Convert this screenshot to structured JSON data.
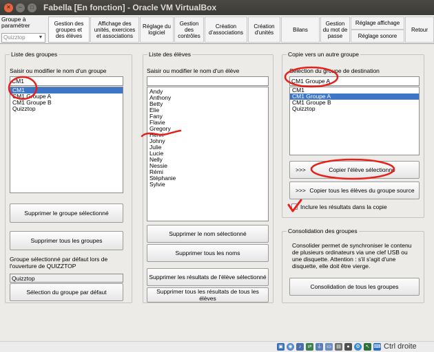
{
  "window": {
    "title": "Fabella [En fonction] - Oracle VM VirtualBox"
  },
  "toolbar": {
    "combo_label": "Groupe à\nparamétrer",
    "combo_value": "Quizztop",
    "tabs": [
      "Gestion des\ngroupes et\ndes élèves",
      "Affichage des\nunités, exercices\net associations",
      "Réglage du\nlogiciel",
      "Gestion\ndes\ncontrôles",
      "Création\nd'associations",
      "Création\nd'unités",
      "Bilans",
      "Gestion\ndu mot de\npasse",
      "Réglage affichage",
      "Réglage sonore",
      "Retour"
    ]
  },
  "groups_panel": {
    "legend": "Liste des groupes",
    "input_label": "Saisir ou modifier le nom d'un groupe",
    "input_value": "CM1",
    "items": [
      "CM1",
      "CM1 Groupe A",
      "CM1 Groupe B",
      "Quizztop"
    ],
    "selected_index": 0,
    "delete_selected": "Supprimer le groupe sélectionné",
    "delete_all": "Supprimer tous les groupes",
    "default_label": "Groupe sélectionné par défaut lors de\nl'ouverture de QUIZZTOP",
    "default_value": "Quizztop",
    "set_default": "Sélection du groupe par défaut"
  },
  "students_panel": {
    "legend": "Liste des élèves",
    "input_label": "Saisir ou modifier le nom d'un élève",
    "input_value": "",
    "items": [
      "Andy",
      "Anthony",
      "Betty",
      "Elie",
      "Fany",
      "Flavie",
      "Gregory",
      "Henri",
      "Johny",
      "Julie",
      "Lucie",
      "Nelly",
      "Nessie",
      "Rémi",
      "Stéphanie",
      "Sylvie"
    ],
    "delete_name": "Supprimer le nom sélectionné",
    "delete_all_names": "Supprimer tous les noms",
    "delete_results_selected": "Supprimer les résultats de l'élève sélectionné",
    "delete_results_all": "Supprimer tous les résultats de tous les élèves"
  },
  "copy_panel": {
    "legend": "Copie vers un autre groupe",
    "dest_label": "Sélection du groupe de destination",
    "dest_value": "CM1 Groupe A",
    "items": [
      "CM1",
      "CM1 Groupe A",
      "CM1 Groupe B",
      "Quizztop"
    ],
    "selected_index": 1,
    "arrow_prefix": ">>>",
    "copy_selected": "Copier l'élève sélectionné",
    "copy_all": "Copier tous les élèves du groupe source",
    "include_results": "Inclure les résultats dans la copie"
  },
  "consolidation_panel": {
    "legend": "Consolidation des groupes",
    "description": "Consolider permet de synchroniser le contenu\nde plusieurs ordinateurs via une clef USB ou\nune disquette. Attention : s'il s'agit d'une\ndisquette, elle doit être vierge.",
    "button": "Consolidation de tous les groupes"
  },
  "statusbar": {
    "host_key": "Ctrl droite"
  },
  "colors": {
    "selection": "#3b76c9",
    "annotation": "#e8201a",
    "titlebar": "#3c3b37"
  }
}
